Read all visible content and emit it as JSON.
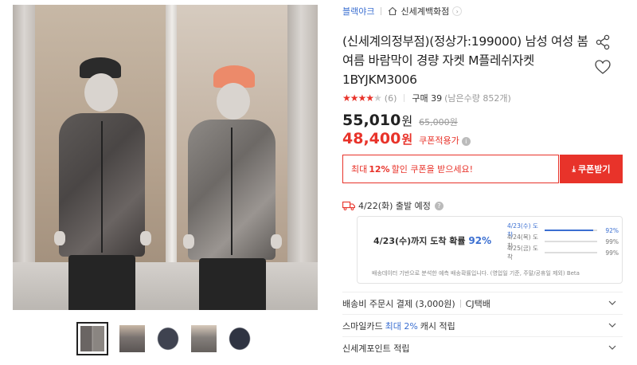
{
  "breadcrumb": {
    "brand": "블랙야크",
    "store": "신세계백화점"
  },
  "product": {
    "title": "(신세계의정부점)(정상가:199000) 남성 여성 봄여름 바람막이 경량 자켓 M플레쉬자켓 1BYJKM3006",
    "rating_value": 4.5,
    "review_count": "(6)",
    "purchase_text": "구매 39",
    "remain_text": "(남은수량 852개)",
    "price": "55,010",
    "price_unit": "원",
    "original_price": "65,000원",
    "coupon_price": "48,400",
    "coupon_price_unit": "원",
    "coupon_price_label": "쿠폰적용가"
  },
  "coupon": {
    "text_pre": "최대",
    "text_bold": "12%",
    "text_post": "할인 쿠폰을 받으세요!",
    "button_label": "쿠폰받기"
  },
  "shipping": {
    "departure": "4/22(화) 출발 예정"
  },
  "prediction": {
    "headline_pre": "4/23(수)까지 도착 확률",
    "headline_pct": "92%",
    "rows": [
      {
        "label": "4/23(수) 도착",
        "value": "92%",
        "fill": 0.92
      },
      {
        "label": "4/24(목) 도착",
        "value": "99%",
        "fill": 0.99
      },
      {
        "label": "4/25(금) 도착",
        "value": "99%",
        "fill": 0.99
      }
    ],
    "footnote": "배송데이터 기반으로 분석한 예측 배송확률입니다. (영업일 기준, 주말/공휴일 제외) Beta"
  },
  "accordion": {
    "shipping_label": "배송비 주문시 결제 (3,000원)",
    "carrier": "CJ택배",
    "card_pre": "스마일카드",
    "card_blue": "최대 2%",
    "card_post": "캐시 적립",
    "points_label": "신세계포인트 적립"
  },
  "colors": {
    "accent_red": "#e8332a",
    "accent_blue": "#3b6fd1"
  }
}
